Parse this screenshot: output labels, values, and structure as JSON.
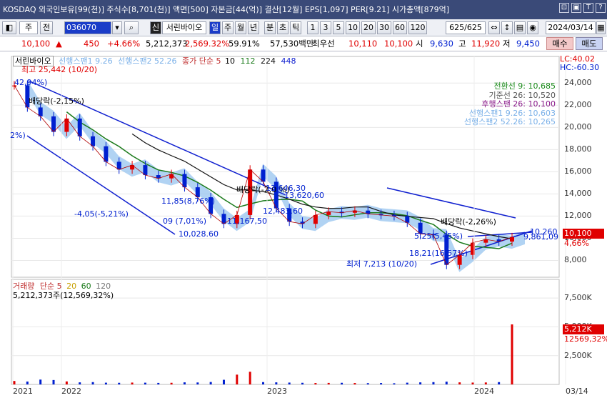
{
  "window": {
    "title": "KOSDAQ 외국인보유[99(천)] 주식수[8,701(천)] 액면[500] 자본금[44(억)] 결산[12월] EPS[1,097] PER[9.21] 시가총액[879억]",
    "buttons": [
      "⊡",
      "▣",
      "T",
      "?"
    ]
  },
  "toolbar": {
    "icon1": "◧",
    "kind": "주",
    "mode": "전",
    "code": "036070",
    "search_icon": "🔍",
    "sin": "신",
    "stock_name": "서린바이오",
    "periods": [
      "일",
      "주",
      "월",
      "년",
      "분",
      "초",
      "틱"
    ],
    "intervals": [
      "1",
      "3",
      "5",
      "10",
      "20",
      "30",
      "60",
      "120"
    ],
    "count": "625/625",
    "date": "2024/03/14"
  },
  "quote": {
    "price": "10,100",
    "arrow": "▲",
    "change": "450",
    "change_pct": "+4.66%",
    "volume": "5,212,373",
    "volume_pct": "2,569.32%",
    "turnover": "59.91%",
    "amount": "57,530백만",
    "best_label": "최우선",
    "bid1": "10,110",
    "bid2": "10,100",
    "open_label": "시",
    "open": "9,630",
    "high_label": "고",
    "high": "11,920",
    "low_label": "저",
    "low": "9,450",
    "buy": "매수",
    "sell": "매도"
  },
  "chart_legend": {
    "name": "서린바이오",
    "span1": "선행스팬1 9.26",
    "span2": "선행스팬2 52.26",
    "ma_label": "종가 단순 5",
    "ma10": "10",
    "ma112": "112",
    "ma224": "224",
    "ma448": "448",
    "lc": "LC:40.02",
    "hc": "HC:-60.30",
    "high_note": "최고 25,442 (10/20)",
    "low_note": "최저 7,213 (10/20)"
  },
  "ichimoku_legend": [
    {
      "text": "전환선 9: 10,685",
      "color": "#1a8a1a"
    },
    {
      "text": "기준선 26: 10,520",
      "color": "#555555"
    },
    {
      "text": "후행스팬 26: 10,100",
      "color": "#8a1a8a"
    },
    {
      "text": "선행스팬1 9.26: 10,603",
      "color": "#7ab0e8"
    },
    {
      "text": "선행스팬2 52.26: 10,265",
      "color": "#7ab0e8"
    }
  ],
  "annotations": [
    {
      "text": "42,94%)"
    },
    {
      "text": "배당락(-2,15%)"
    },
    {
      "text": "2%)"
    },
    {
      "text": "-4,05(-5,21%)"
    },
    {
      "text": "11,85(8,76%)"
    },
    {
      "text": "09 (7,01%)"
    },
    {
      "text": "10,028.60"
    },
    {
      "text": "11,167,50"
    },
    {
      "text": "배당락(-2,0 %)"
    },
    {
      "text": "13,646,30"
    },
    {
      "text": "13,620,60"
    },
    {
      "text": "12,483.60"
    },
    {
      "text": "배당락(-2,26%)"
    },
    {
      "text": "5,25(5,45%)"
    },
    {
      "text": "18,21(16,57%)"
    },
    {
      "text": "10,260"
    },
    {
      "text": "9,861,09"
    }
  ],
  "price_axis": [
    "24,000",
    "22,000",
    "20,000",
    "18,000",
    "16,000",
    "14,000",
    "12,000",
    "10,000",
    "8,000"
  ],
  "price_tag": {
    "value": "10,100",
    "pct": "4,66%"
  },
  "volume_legend": {
    "label": "거래량",
    "ma_label": "단순 5",
    "ma20": "20",
    "ma60": "60",
    "ma120": "120",
    "current": "5,212,373주(12,569,32%)"
  },
  "volume_axis": [
    "7,500K",
    "5,000K",
    "2,500K"
  ],
  "volume_tag": {
    "value": "5,212K",
    "pct": "12569,32%"
  },
  "date_axis": [
    "2021",
    "2022",
    "2023",
    "2024",
    "03/14"
  ],
  "colors": {
    "up": "#e00000",
    "down": "#0020d0",
    "cloud": "#9ec8f0",
    "ma_green": "#1a7a1a",
    "ma_black": "#111111",
    "trend": "#1020d0"
  },
  "chart_data": {
    "type": "line",
    "title": "서린바이오",
    "ylim": [
      7000,
      25500
    ],
    "points": [
      [
        "2021-01",
        23800
      ],
      [
        "2021-02",
        21800
      ],
      [
        "2021-03",
        21000
      ],
      [
        "2021-04",
        19600
      ],
      [
        "2021-05",
        20800
      ],
      [
        "2021-06",
        19200
      ],
      [
        "2021-07",
        18300
      ],
      [
        "2021-08",
        16900
      ],
      [
        "2021-09",
        16200
      ],
      [
        "2021-10",
        16600
      ],
      [
        "2021-11",
        15700
      ],
      [
        "2021-12",
        15400
      ],
      [
        "2022-01",
        15800
      ],
      [
        "2022-02",
        14600
      ],
      [
        "2022-03",
        13700
      ],
      [
        "2022-04",
        12200
      ],
      [
        "2022-05",
        11300
      ],
      [
        "2022-06",
        12100
      ],
      [
        "2022-07",
        16200
      ],
      [
        "2022-08",
        15100
      ],
      [
        "2022-09",
        12700
      ],
      [
        "2022-10",
        11500
      ],
      [
        "2022-11",
        11300
      ],
      [
        "2022-12",
        12100
      ],
      [
        "2023-01",
        12400
      ],
      [
        "2023-02",
        12300
      ],
      [
        "2023-03",
        12500
      ],
      [
        "2023-04",
        12200
      ],
      [
        "2023-05",
        12100
      ],
      [
        "2023-06",
        12000
      ],
      [
        "2023-07",
        11400
      ],
      [
        "2023-08",
        10400
      ],
      [
        "2023-09",
        10300
      ],
      [
        "2023-10",
        7600
      ],
      [
        "2023-11",
        8500
      ],
      [
        "2023-12",
        9600
      ],
      [
        "2024-01",
        9900
      ],
      [
        "2024-02",
        9700
      ],
      [
        "2024-03",
        10100
      ]
    ],
    "volume": [
      300,
      250,
      420,
      380,
      260,
      180,
      200,
      150,
      140,
      160,
      150,
      130,
      140,
      180,
      170,
      210,
      400,
      850,
      1100,
      200,
      180,
      160,
      140,
      120,
      130,
      140,
      120,
      110,
      120,
      100,
      150,
      180,
      200,
      240,
      180,
      160,
      170,
      200,
      5212
    ]
  }
}
